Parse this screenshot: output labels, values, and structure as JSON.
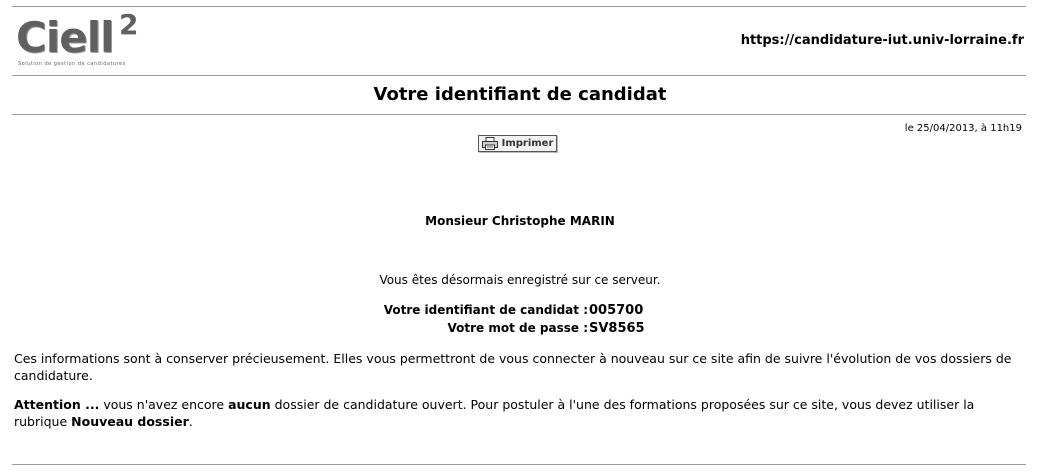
{
  "header": {
    "logo_text": "Ciell",
    "logo_superscript": "2",
    "logo_tagline": "Solution de gestion de candidatures",
    "site_url": "https://candidature-iut.univ-lorraine.fr"
  },
  "page": {
    "title": "Votre identifiant de candidat",
    "date": "le 25/04/2013, à 11h19"
  },
  "toolbar": {
    "print_label": "Imprimer",
    "print_icon": "printer-icon"
  },
  "candidate": {
    "name": "Monsieur Christophe MARIN",
    "registered_message": "Vous êtes désormais enregistré sur ce serveur."
  },
  "credentials": {
    "id_label": "Votre identifiant de candidat :",
    "id_value": "005700",
    "password_label": "Votre mot de passe :",
    "password_value": "SV8565"
  },
  "info": {
    "text": "Ces informations sont à conserver précieusement. Elles vous permettront de vous connecter à nouveau sur ce site afin de suivre l'évolution de vos dossiers de candidature."
  },
  "attention": {
    "label": "Attention ...",
    "part1": " vous n'avez encore ",
    "emphasis": "aucun",
    "part2": " dossier de candidature ouvert. Pour postuler à l'une des formations proposées sur ce site, vous devez utiliser la rubrique ",
    "link": "Nouveau dossier",
    "end": "."
  }
}
